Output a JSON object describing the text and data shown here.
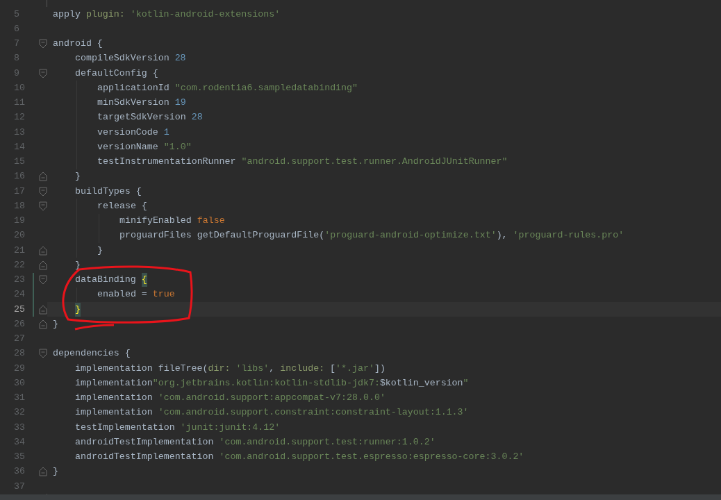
{
  "editor": {
    "lines": [
      {
        "number": "5",
        "tokens": [
          {
            "kind": "plain",
            "text": "apply "
          },
          {
            "kind": "label",
            "text": "plugin: "
          },
          {
            "kind": "string",
            "text": "'kotlin-android-extensions'"
          }
        ]
      },
      {
        "number": "6"
      },
      {
        "number": "7",
        "kind": "start",
        "tokens": [
          {
            "kind": "plain",
            "text": "android {"
          }
        ],
        "children": [
          {
            "number": "8",
            "tokens": [
              {
                "kind": "plain",
                "text": "compileSdkVersion "
              },
              {
                "kind": "number",
                "text": "28"
              }
            ]
          },
          {
            "number": "9",
            "kind": "start",
            "tokens": [
              {
                "kind": "plain",
                "text": "defaultConfig {"
              }
            ],
            "children": [
              {
                "number": "10",
                "tokens": [
                  {
                    "kind": "plain",
                    "text": "applicationId "
                  },
                  {
                    "kind": "string",
                    "text": "\"com.rodentia6.sampledatabinding\""
                  }
                ]
              },
              {
                "number": "11",
                "tokens": [
                  {
                    "kind": "plain",
                    "text": "minSdkVersion "
                  },
                  {
                    "kind": "number",
                    "text": "19"
                  }
                ]
              },
              {
                "number": "12",
                "tokens": [
                  {
                    "kind": "plain",
                    "text": "targetSdkVersion "
                  },
                  {
                    "kind": "number",
                    "text": "28"
                  }
                ]
              },
              {
                "number": "13",
                "tokens": [
                  {
                    "kind": "plain",
                    "text": "versionCode "
                  },
                  {
                    "kind": "number",
                    "text": "1"
                  }
                ]
              },
              {
                "number": "14",
                "tokens": [
                  {
                    "kind": "plain",
                    "text": "versionName "
                  },
                  {
                    "kind": "string",
                    "text": "\"1.0\""
                  }
                ]
              },
              {
                "number": "15",
                "tokens": [
                  {
                    "kind": "plain",
                    "text": "testInstrumentationRunner "
                  },
                  {
                    "kind": "string",
                    "text": "\"android.support.test.runner.AndroidJUnitRunner\""
                  }
                ]
              }
            ]
          },
          {
            "number": "16",
            "kind": "end",
            "tokens": [
              {
                "kind": "plain",
                "text": "}"
              }
            ]
          },
          {
            "number": "17",
            "kind": "start",
            "tokens": [
              {
                "kind": "plain",
                "text": "buildTypes {"
              }
            ],
            "children": [
              {
                "number": "18",
                "kind": "start",
                "tokens": [
                  {
                    "kind": "plain",
                    "text": "release {"
                  }
                ],
                "children": [
                  {
                    "number": "19",
                    "tokens": [
                      {
                        "kind": "plain",
                        "text": "minifyEnabled "
                      },
                      {
                        "kind": "keyword",
                        "text": "false"
                      }
                    ]
                  },
                  {
                    "number": "20",
                    "tokens": [
                      {
                        "kind": "plain",
                        "text": "proguardFiles getDefaultProguardFile("
                      },
                      {
                        "kind": "string",
                        "text": "'proguard-android-optimize.txt'"
                      },
                      {
                        "kind": "plain",
                        "text": "), "
                      },
                      {
                        "kind": "string",
                        "text": "'proguard-rules.pro'"
                      }
                    ]
                  }
                ]
              },
              {
                "number": "21",
                "kind": "end",
                "tokens": [
                  {
                    "kind": "plain",
                    "text": "}"
                  }
                ]
              }
            ]
          },
          {
            "number": "22",
            "kind": "end",
            "tokens": [
              {
                "kind": "plain",
                "text": "}"
              }
            ]
          },
          {
            "number": "23",
            "kind": "start",
            "changed": true,
            "tokens": [
              {
                "kind": "plain",
                "text": "dataBinding "
              },
              {
                "kind": "brace",
                "text": "{"
              }
            ],
            "children": [
              {
                "number": "24",
                "changed": true,
                "tokens": [
                  {
                    "kind": "plain",
                    "text": "enabled = "
                  },
                  {
                    "kind": "keyword",
                    "text": "true"
                  }
                ]
              }
            ]
          },
          {
            "number": "25",
            "kind": "end",
            "changed": true,
            "current": true,
            "tokens": [
              {
                "kind": "brace",
                "text": "}"
              }
            ]
          }
        ]
      },
      {
        "number": "26",
        "kind": "end",
        "tokens": [
          {
            "kind": "plain",
            "text": "}"
          }
        ]
      },
      {
        "number": "27"
      },
      {
        "number": "28",
        "kind": "start",
        "tokens": [
          {
            "kind": "plain",
            "text": "dependencies {"
          }
        ],
        "children": [
          {
            "number": "29",
            "tokens": [
              {
                "kind": "plain",
                "text": "implementation fileTree("
              },
              {
                "kind": "label",
                "text": "dir: "
              },
              {
                "kind": "string",
                "text": "'libs'"
              },
              {
                "kind": "plain",
                "text": ", "
              },
              {
                "kind": "label",
                "text": "include: "
              },
              {
                "kind": "plain",
                "text": "["
              },
              {
                "kind": "string",
                "text": "'*.jar'"
              },
              {
                "kind": "plain",
                "text": "])"
              }
            ]
          },
          {
            "number": "30",
            "tokens": [
              {
                "kind": "plain",
                "text": "implementation"
              },
              {
                "kind": "string",
                "text": "\"org.jetbrains.kotlin:kotlin-stdlib-jdk7:"
              },
              {
                "kind": "plain",
                "text": "$kotlin_version"
              },
              {
                "kind": "string",
                "text": "\""
              }
            ]
          },
          {
            "number": "31",
            "tokens": [
              {
                "kind": "plain",
                "text": "implementation "
              },
              {
                "kind": "string",
                "text": "'com.android.support:appcompat-v7:28.0.0'"
              }
            ]
          },
          {
            "number": "32",
            "tokens": [
              {
                "kind": "plain",
                "text": "implementation "
              },
              {
                "kind": "string",
                "text": "'com.android.support.constraint:constraint-layout:1.1.3'"
              }
            ]
          },
          {
            "number": "33",
            "tokens": [
              {
                "kind": "plain",
                "text": "testImplementation "
              },
              {
                "kind": "string",
                "text": "'junit:junit:4.12'"
              }
            ]
          },
          {
            "number": "34",
            "tokens": [
              {
                "kind": "plain",
                "text": "androidTestImplementation "
              },
              {
                "kind": "string",
                "text": "'com.android.support.test:runner:1.0.2'"
              }
            ]
          },
          {
            "number": "35",
            "tokens": [
              {
                "kind": "plain",
                "text": "androidTestImplementation "
              },
              {
                "kind": "string",
                "text": "'com.android.support.test.espresso:espresso-core:3.0.2'"
              }
            ]
          }
        ]
      },
      {
        "number": "36",
        "kind": "end",
        "tokens": [
          {
            "kind": "plain",
            "text": "}"
          }
        ]
      },
      {
        "number": "37"
      }
    ]
  }
}
